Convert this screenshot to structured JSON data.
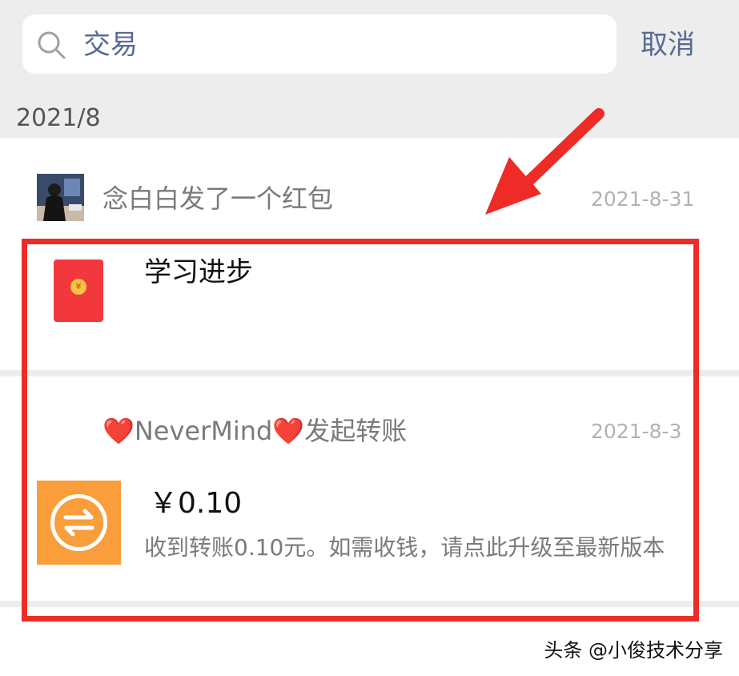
{
  "search": {
    "value": "交易",
    "cancel_label": "取消"
  },
  "month_header": "2021/8",
  "records": [
    {
      "title": "念白白发了一个红包",
      "date": "2021-8-31",
      "content_title": "学习进步",
      "icon": "red-packet-icon",
      "icon_glyph": "¥"
    },
    {
      "title": "❤️NeverMind❤️发起转账",
      "date": "2021-8-3",
      "amount": "￥0.10",
      "description": "收到转账0.10元。如需收钱，请点此升级至最新版本",
      "icon": "transfer-icon"
    }
  ],
  "annotation": {
    "color": "#ee2b27"
  },
  "watermark": "头条 @小俊技术分享",
  "colors": {
    "link": "#576b95",
    "background_gray": "#ededed",
    "transfer_orange": "#fa9d3b",
    "red_packet": "#f2383c"
  }
}
